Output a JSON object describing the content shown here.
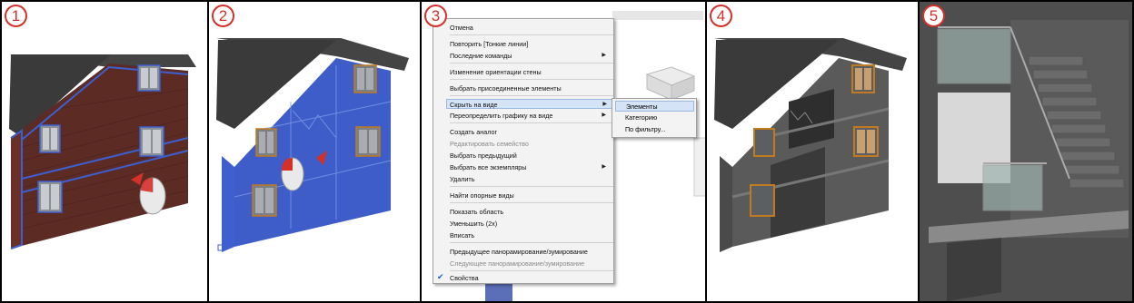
{
  "panels": [
    {
      "number": "1"
    },
    {
      "number": "2"
    },
    {
      "number": "3"
    },
    {
      "number": "4"
    },
    {
      "number": "5"
    }
  ],
  "context_menu": {
    "items": [
      {
        "label": "Отмена",
        "enabled": true,
        "submenu": false
      },
      {
        "label": "Повторить [Тонкие линии]",
        "enabled": true,
        "submenu": false
      },
      {
        "label": "Последние команды",
        "enabled": true,
        "submenu": true
      },
      {
        "label": "Изменение ориентации стены",
        "enabled": true,
        "submenu": false
      },
      {
        "label": "Выбрать присоединенные элементы",
        "enabled": true,
        "submenu": false
      },
      {
        "label": "Скрыть на виде",
        "enabled": true,
        "submenu": true,
        "highlighted": true
      },
      {
        "label": "Переопределить графику на виде",
        "enabled": true,
        "submenu": true
      },
      {
        "label": "Создать аналог",
        "enabled": true,
        "submenu": false
      },
      {
        "label": "Редактировать семейство",
        "enabled": false,
        "submenu": false
      },
      {
        "label": "Выбрать предыдущий",
        "enabled": true,
        "submenu": false
      },
      {
        "label": "Выбрать все экземпляры",
        "enabled": true,
        "submenu": true
      },
      {
        "label": "Удалить",
        "enabled": true,
        "submenu": false
      },
      {
        "label": "Найти опорные виды",
        "enabled": true,
        "submenu": false
      },
      {
        "label": "Показать область",
        "enabled": true,
        "submenu": false
      },
      {
        "label": "Уменьшить (2x)",
        "enabled": true,
        "submenu": false
      },
      {
        "label": "Вписать",
        "enabled": true,
        "submenu": false
      },
      {
        "label": "Предыдущее панорамирование/зумирование",
        "enabled": true,
        "submenu": false
      },
      {
        "label": "Следующее панорамирование/зумирование",
        "enabled": false,
        "submenu": false
      },
      {
        "label": "Свойства",
        "enabled": true,
        "submenu": false,
        "checked": true
      }
    ],
    "submenu_items": [
      {
        "label": "Элементы",
        "highlighted": true
      },
      {
        "label": "Категорию",
        "highlighted": false
      },
      {
        "label": "По фильтру...",
        "highlighted": false
      }
    ]
  },
  "colors": {
    "badge": "#d4302a",
    "brick": "#5a2a22",
    "roof": "#3d3d3d",
    "selection_blue": "#3d5fd0",
    "menu_bg": "#f3f3f3",
    "menu_highlight": "#d5e3f6",
    "window_frame": "#c07a20"
  },
  "icons": [
    "mouse-icon",
    "checkmark-icon",
    "submenu-arrow-icon",
    "view-cube-icon"
  ]
}
